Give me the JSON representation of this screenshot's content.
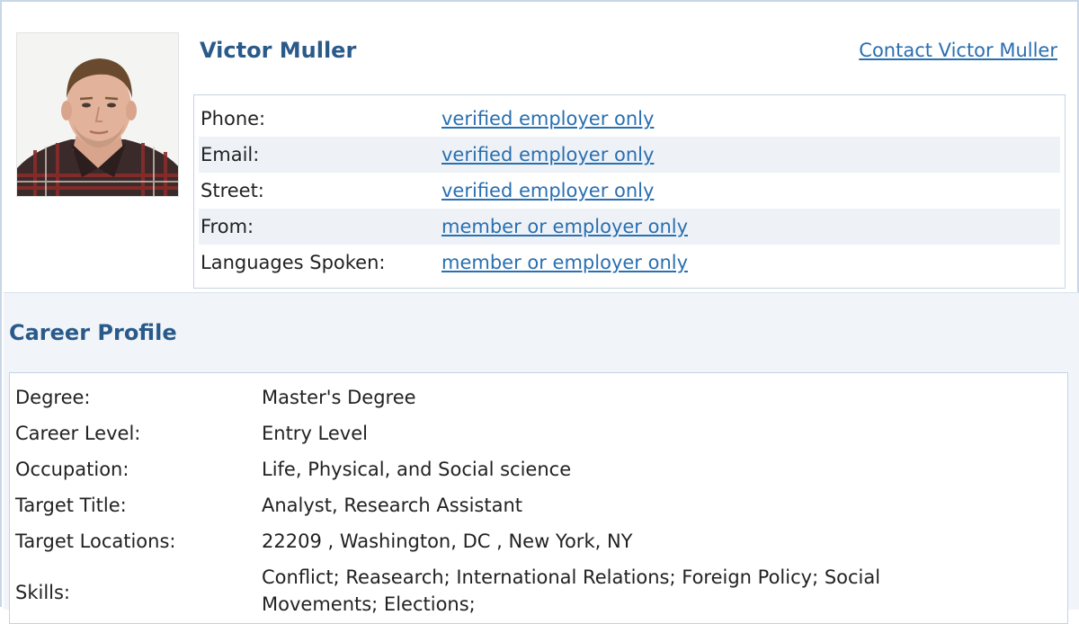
{
  "profile": {
    "name": "Victor Muller",
    "contact_link": "Contact Victor Muller",
    "contact_rows": [
      {
        "label": "Phone:",
        "value": "verified employer only"
      },
      {
        "label": "Email:",
        "value": "verified employer only"
      },
      {
        "label": "Street:",
        "value": "verified employer only"
      },
      {
        "label": "From:",
        "value": "member or employer only"
      },
      {
        "label": "Languages Spoken:",
        "value": "member or employer only"
      }
    ]
  },
  "career": {
    "title": "Career Profile",
    "rows": [
      {
        "label": "Degree:",
        "value": "Master's Degree"
      },
      {
        "label": "Career Level:",
        "value": "Entry Level"
      },
      {
        "label": "Occupation:",
        "value": "Life, Physical, and Social science"
      },
      {
        "label": "Target Title:",
        "value": "Analyst, Research Assistant"
      },
      {
        "label": "Target Locations:",
        "value": "22209 , Washington, DC , New York, NY"
      },
      {
        "label": "Skills:",
        "value": "Conflict; Reasearch; International Relations; Foreign Policy; Social Movements; Elections;"
      }
    ]
  },
  "colors": {
    "heading": "#2a5a8a",
    "link": "#2a6fb0",
    "border": "#c6d3e2",
    "alt_row": "#eef2f7",
    "section_bg": "#f1f5f9"
  }
}
